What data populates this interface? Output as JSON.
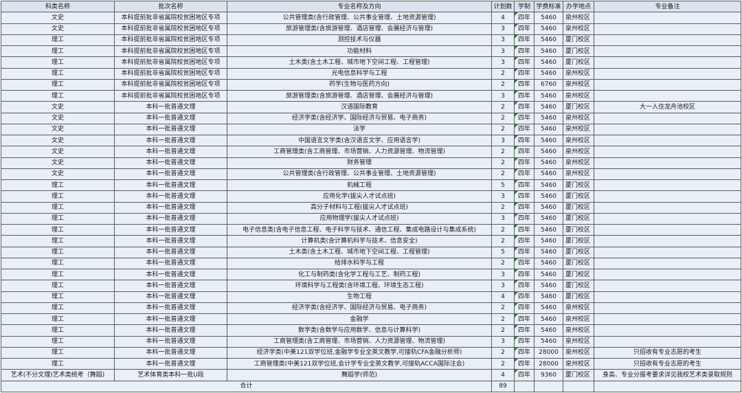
{
  "headers": [
    "科类名称",
    "批次名称",
    "专业名称及方向",
    "计划数",
    "学制",
    "学费标准",
    "办学地点",
    "专业备注"
  ],
  "rows": [
    [
      "文史",
      "本科提前批非省属院校贫困地区专项",
      "公共管理类(含行政管理、公共事业管理、土地资源管理)",
      "4",
      "四年",
      "5460",
      "泉州校区",
      ""
    ],
    [
      "文史",
      "本科提前批非省属院校贫困地区专项",
      "旅游管理类(含旅游管理、酒店管理、会展经济与管理)",
      "3",
      "四年",
      "5460",
      "泉州校区",
      ""
    ],
    [
      "理工",
      "本科提前批非省属院校贫困地区专项",
      "测控技术与仪器",
      "3",
      "四年",
      "5460",
      "厦门校区",
      ""
    ],
    [
      "理工",
      "本科提前批非省属院校贫困地区专项",
      "功能材料",
      "3",
      "四年",
      "5460",
      "厦门校区",
      ""
    ],
    [
      "理工",
      "本科提前批非省属院校贫困地区专项",
      "土木类(含土木工程、城市地下空间工程、工程管理)",
      "3",
      "四年",
      "5460",
      "厦门校区",
      ""
    ],
    [
      "理工",
      "本科提前批非省属院校贫困地区专项",
      "光电信息科学与工程",
      "2",
      "四年",
      "5460",
      "泉州校区",
      ""
    ],
    [
      "理工",
      "本科提前批非省属院校贫困地区专项",
      "药学(生物与医药方向)",
      "2",
      "四年",
      "6760",
      "泉州校区",
      ""
    ],
    [
      "理工",
      "本科提前批非省属院校贫困地区专项",
      "旅游管理类(含旅游管理、酒店管理、会展经济与管理)",
      "3",
      "四年",
      "5460",
      "泉州校区",
      ""
    ],
    [
      "文史",
      "本科一批普通文理",
      "汉语国际教育",
      "2",
      "四年",
      "5460",
      "厦门校区",
      "大一入住龙舟池校区"
    ],
    [
      "文史",
      "本科一批普通文理",
      "经济学类(含经济学、国际经济与贸易、电子商务)",
      "2",
      "四年",
      "5460",
      "泉州校区",
      ""
    ],
    [
      "文史",
      "本科一批普通文理",
      "法学",
      "2",
      "四年",
      "5460",
      "泉州校区",
      ""
    ],
    [
      "文史",
      "本科一批普通文理",
      "中国语言文学类(含汉语言文学、应用语言学)",
      "3",
      "四年",
      "5460",
      "泉州校区",
      ""
    ],
    [
      "文史",
      "本科一批普通文理",
      "工商管理类(含工商管理、市场营销、人力资源管理、物流管理)",
      "2",
      "四年",
      "5460",
      "泉州校区",
      ""
    ],
    [
      "文史",
      "本科一批普通文理",
      "财务管理",
      "2",
      "四年",
      "5460",
      "泉州校区",
      ""
    ],
    [
      "文史",
      "本科一批普通文理",
      "公共管理类(含行政管理、公共事业管理、土地资源管理)",
      "2",
      "四年",
      "5460",
      "泉州校区",
      ""
    ],
    [
      "理工",
      "本科一批普通文理",
      "机械工程",
      "5",
      "四年",
      "5460",
      "厦门校区",
      ""
    ],
    [
      "理工",
      "本科一批普通文理",
      "应用化学(拔尖人才试点班)",
      "3",
      "四年",
      "5460",
      "厦门校区",
      ""
    ],
    [
      "理工",
      "本科一批普通文理",
      "高分子材料与工程(拔尖人才试点班)",
      "2",
      "四年",
      "5460",
      "厦门校区",
      ""
    ],
    [
      "理工",
      "本科一批普通文理",
      "应用物理学(拔尖人才试点班)",
      "3",
      "四年",
      "5460",
      "厦门校区",
      ""
    ],
    [
      "理工",
      "本科一批普通文理",
      "电子信息类(含电子信息工程、电子科学与技术、通信工程、集成电路设计与集成系统)",
      "2",
      "四年",
      "5460",
      "厦门校区",
      ""
    ],
    [
      "理工",
      "本科一批普通文理",
      "计算机类(含计算机科学与技术、信息安全)",
      "2",
      "四年",
      "5460",
      "厦门校区",
      ""
    ],
    [
      "理工",
      "本科一批普通文理",
      "土木类(含土木工程、城市地下空间工程、工程管理)",
      "5",
      "四年",
      "5460",
      "厦门校区",
      ""
    ],
    [
      "理工",
      "本科一批普通文理",
      "给排水科学与工程",
      "2",
      "四年",
      "5460",
      "厦门校区",
      ""
    ],
    [
      "理工",
      "本科一批普通文理",
      "化工与制药类(含化学工程与工艺、制药工程)",
      "3",
      "四年",
      "5460",
      "厦门校区",
      ""
    ],
    [
      "理工",
      "本科一批普通文理",
      "环境科学与工程类(含环境工程、环境生态工程)",
      "3",
      "四年",
      "5460",
      "厦门校区",
      ""
    ],
    [
      "理工",
      "本科一批普通文理",
      "生物工程",
      "4",
      "四年",
      "5460",
      "厦门校区",
      ""
    ],
    [
      "理工",
      "本科一批普通文理",
      "经济学类(含经济学、国际经济与贸易、电子商务)",
      "2",
      "四年",
      "5460",
      "泉州校区",
      ""
    ],
    [
      "理工",
      "本科一批普通文理",
      "金融学",
      "2",
      "四年",
      "5460",
      "泉州校区",
      ""
    ],
    [
      "理工",
      "本科一批普通文理",
      "数学类(含数学与应用数学、信息与计算科学)",
      "2",
      "四年",
      "5460",
      "泉州校区",
      ""
    ],
    [
      "理工",
      "本科一批普通文理",
      "工商管理类(含工商管理、市场营销、人力资源管理、物流管理)",
      "3",
      "四年",
      "5460",
      "泉州校区",
      ""
    ],
    [
      "理工",
      "本科一批普通文理",
      "经济学类(中美121双学位班,金融学专业全英文教学,可接轨CFA金融分析师)",
      "2",
      "四年",
      "28000",
      "泉州校区",
      "只招收有专业志愿的考生"
    ],
    [
      "理工",
      "本科一批普通文理",
      "工商管理类(中美121双学位班,会计学专业全英文教学,可接轨ACCA国际注会)",
      "2",
      "四年",
      "28000",
      "泉州校区",
      "只招收有专业志愿的考生"
    ],
    [
      "艺术(不分文理)艺术类统考（舞蹈)",
      "艺术体育类本科一批U段",
      "舞蹈学(师范)",
      "4",
      "四年",
      "9360",
      "厦门校区",
      "身高、专业分报考要求详见我校艺术类录取规则"
    ]
  ],
  "total": {
    "label": "合计",
    "value": "89"
  },
  "colors": {
    "header_bg": "#dbe3ef",
    "row_bg": "#e9eff7",
    "grid": "#5a5a5a",
    "flag": "#2e7d32"
  }
}
